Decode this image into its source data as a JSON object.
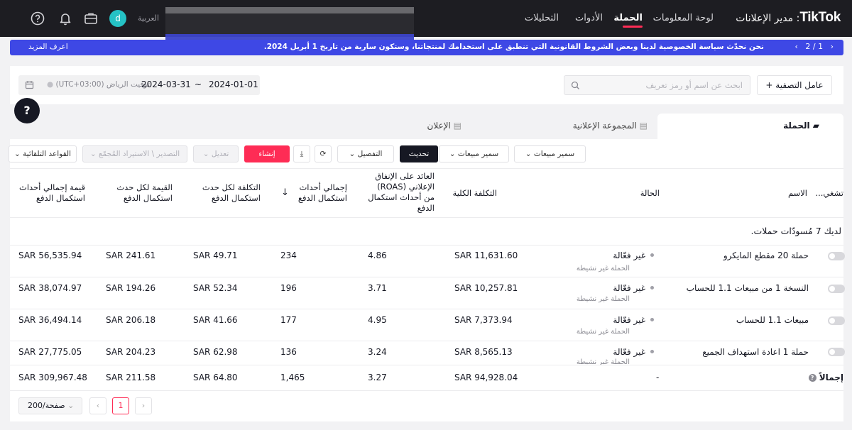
{
  "topnav": {
    "brand_logo": "TikTok",
    "brand_sub": ": مدير الإعلانات",
    "tabs": [
      {
        "label": "لوحة المعلومات"
      },
      {
        "label": "الحملة"
      },
      {
        "label": "الأدوات"
      },
      {
        "label": "التحليلات"
      }
    ],
    "language": "العربية",
    "avatar_letter": "d",
    "icons": [
      "help-circle-icon",
      "bell-icon",
      "briefcase-icon"
    ]
  },
  "banner": {
    "message": "نحن نحدّث سياسة الخصوصية لدينا وبعض الشروط القانونية التي تنطبق على استخدامك لمنتجاتنا، وستكون سارية من تاريخ 1 أبريل 2024.",
    "more_link": "اعرف المزيد",
    "page_current": "1",
    "page_sep": "/",
    "page_total": "2",
    "color": "#3e48e5"
  },
  "filters": {
    "filter_button": "عامل التصفية",
    "search_placeholder": "ابحث عن اسم أو رمز تعريف",
    "date_start": "2024-01-01",
    "date_sep": "~",
    "date_end": "2024-03-31",
    "timezone": "(UTC+03:00) توقيت الرياض"
  },
  "levels": {
    "tabs": [
      {
        "label": "الحملة"
      },
      {
        "label": "المجموعة الإعلانية"
      },
      {
        "label": "الإعلان"
      }
    ]
  },
  "toolbar": {
    "preset_1": "سمير مبيعات",
    "preset_2": "سمير مبيعات",
    "update": "تحديث",
    "detail": "التفصيل",
    "create": "إنشاء",
    "edit": "تعديل",
    "export_import": "التصدير \\ الاستيراد المُجمّع",
    "auto_rules": "القواعد التلقائية"
  },
  "table": {
    "headers": {
      "toggle": "تشغي...",
      "name": "الاسم",
      "status": "الحالة",
      "total_cost": "التكلفة الكلية",
      "roas_l1": "العائد على الإنفاق",
      "roas_l2": "الإعلاني (ROAS)",
      "roas_l3": "من أحداث استكمال",
      "roas_l4": "الدفع",
      "total_events_l1": "إجمالي أحداث",
      "total_events_l2": "استكمال الدفع",
      "sort_arrow": "↓",
      "cost_per_l1": "التكلفة لكل حدث",
      "cost_per_l2": "استكمال الدفع",
      "value_per_l1": "القيمة لكل حدث",
      "value_per_l2": "استكمال الدفع",
      "total_value_l1": "قيمة إجمالي أحداث",
      "total_value_l2": "استكمال الدفع"
    },
    "drafts_note": "لديك 7 مُسودّات حملات.",
    "rows": [
      {
        "name": "حملة 20 مقطع المايكرو",
        "status": "غير فعّالة",
        "status_sub": "الحملة غير نشيطة",
        "total_cost": "SAR 11,631.60",
        "roas": "4.86",
        "events": "234",
        "cost_per": "SAR 49.71",
        "value_per": "SAR 241.61",
        "total_value": "SAR 56,535.94"
      },
      {
        "name": "النسخة 1 من مبيعات 1.1 للحساب",
        "status": "غير فعّالة",
        "status_sub": "الحملة غير نشيطة",
        "total_cost": "SAR 10,257.81",
        "roas": "3.71",
        "events": "196",
        "cost_per": "SAR 52.34",
        "value_per": "SAR 194.26",
        "total_value": "SAR 38,074.97"
      },
      {
        "name": "مبيعات 1.1 للحساب",
        "status": "غير فعّالة",
        "status_sub": "الحملة غير نشيطة",
        "total_cost": "SAR 7,373.94",
        "roas": "4.95",
        "events": "177",
        "cost_per": "SAR 41.66",
        "value_per": "SAR 206.18",
        "total_value": "SAR 36,494.14"
      },
      {
        "name": "حملة 1 اعادة استهداف الجميع",
        "status": "غير فعّالة",
        "status_sub": "الحملة غير نشيطة",
        "total_cost": "SAR 8,565.13",
        "roas": "3.24",
        "events": "136",
        "cost_per": "SAR 62.98",
        "value_per": "SAR 204.23",
        "total_value": "SAR 27,775.05"
      }
    ],
    "total": {
      "label": "إجمالاً",
      "status": "-",
      "total_cost": "SAR 94,928.04",
      "roas": "3.27",
      "events": "1,465",
      "cost_per": "SAR 64.80",
      "value_per": "SAR 211.58",
      "total_value": "SAR 309,967.48"
    }
  },
  "pagination": {
    "current_page": "1",
    "per_page": "200/صفحة"
  }
}
